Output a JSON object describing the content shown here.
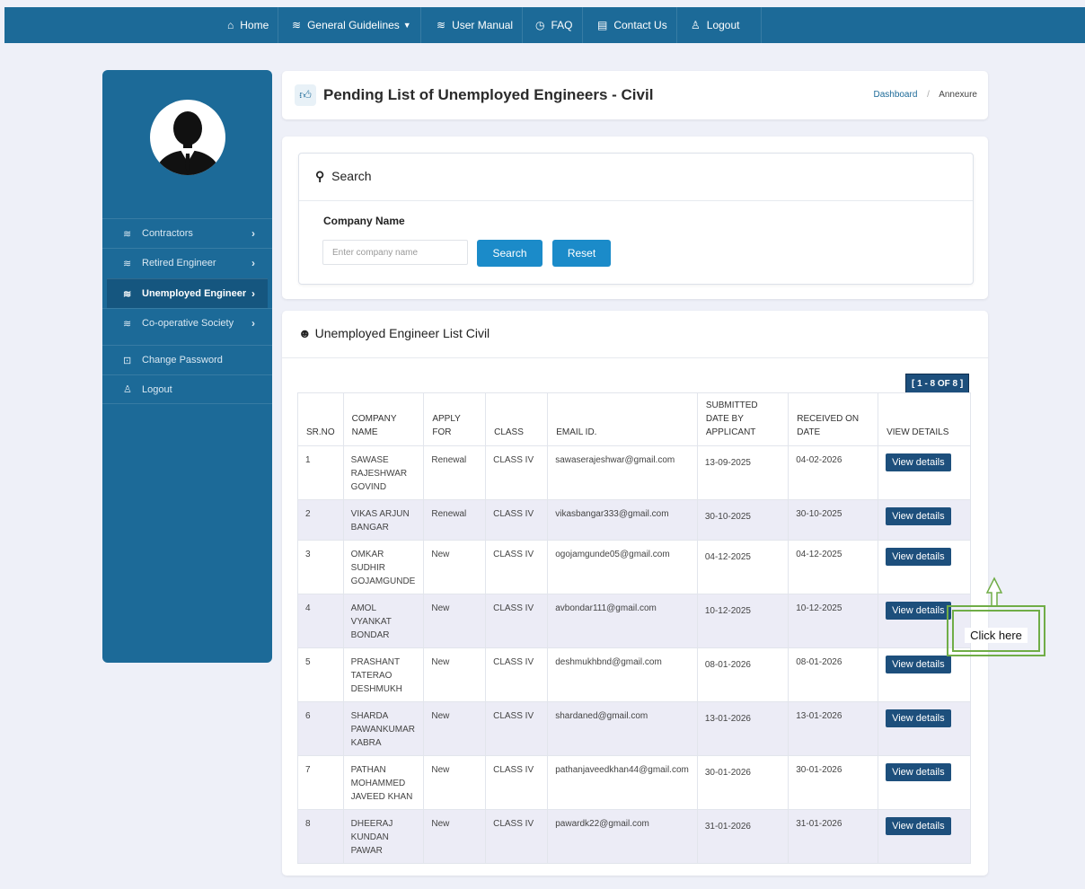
{
  "topnav": {
    "items": [
      {
        "label": "Home",
        "icon": "home-icon"
      },
      {
        "label": "General Guidelines",
        "icon": "layers-icon"
      },
      {
        "label": "User Manual",
        "icon": "layers-icon"
      },
      {
        "label": "FAQ",
        "icon": "clock-icon"
      },
      {
        "label": "Contact Us",
        "icon": "document-icon"
      },
      {
        "label": "Logout",
        "icon": "user-icon"
      }
    ]
  },
  "sidebar": {
    "items": [
      {
        "label": "Contractors",
        "icon": "layers-icon",
        "chevron": "›"
      },
      {
        "label": "Retired Engineer",
        "icon": "layers-icon",
        "chevron": "›"
      },
      {
        "label": "Unemployed Engineer",
        "icon": "layers-icon",
        "chevron": "›",
        "active": true
      },
      {
        "label": "Co-operative Society",
        "icon": "layers-icon",
        "chevron": "›"
      },
      {
        "label": "Change Password",
        "icon": "lock-icon"
      },
      {
        "label": "Logout",
        "icon": "user-icon"
      }
    ]
  },
  "header": {
    "title": "Pending List of Unemployed Engineers - Civil",
    "breadcrumb": {
      "link": "Dashboard",
      "sep": "/",
      "current": "Annexure"
    }
  },
  "search": {
    "title": "Search",
    "field_label": "Company Name",
    "input_value": "",
    "placeholder": "Enter company name",
    "search_label": "Search",
    "reset_label": "Reset"
  },
  "list": {
    "title": "Unemployed Engineer List Civil",
    "count": "[ 1 - 8 OF 8 ]",
    "columns": [
      "SR.NO",
      "COMPANY NAME",
      "APPLY FOR",
      "CLASS",
      "EMAIL ID.",
      "SUBMITTED DATE BY APPLICANT",
      "RECEIVED ON DATE",
      "VIEW DETAILS"
    ],
    "button_label": "View details",
    "rows": [
      {
        "sr": "1",
        "name": "SAWASE RAJESHWAR GOVIND",
        "apply": "Renewal",
        "cls": "CLASS IV",
        "email": "sawaserajeshwar@gmail.com",
        "submitted": "13-09-2025",
        "received": "04-02-2026"
      },
      {
        "sr": "2",
        "name": "VIKAS ARJUN BANGAR",
        "apply": "Renewal",
        "cls": "CLASS IV",
        "email": "vikasbangar333@gmail.com",
        "submitted": "30-10-2025",
        "received": "30-10-2025"
      },
      {
        "sr": "3",
        "name": "OMKAR SUDHIR GOJAMGUNDE",
        "apply": "New",
        "cls": "CLASS IV",
        "email": "ogojamgunde05@gmail.com",
        "submitted": "04-12-2025",
        "received": "04-12-2025"
      },
      {
        "sr": "4",
        "name": "AMOL VYANKAT BONDAR",
        "apply": "New",
        "cls": "CLASS IV",
        "email": "avbondar111@gmail.com",
        "submitted": "10-12-2025",
        "received": "10-12-2025"
      },
      {
        "sr": "5",
        "name": "PRASHANT TATERAO DESHMUKH",
        "apply": "New",
        "cls": "CLASS IV",
        "email": "deshmukhbnd@gmail.com",
        "submitted": "08-01-2026",
        "received": "08-01-2026"
      },
      {
        "sr": "6",
        "name": "SHARDA PAWANKUMAR KABRA",
        "apply": "New",
        "cls": "CLASS IV",
        "email": "shardaned@gmail.com",
        "submitted": "13-01-2026",
        "received": "13-01-2026"
      },
      {
        "sr": "7",
        "name": "PATHAN MOHAMMED JAVEED KHAN",
        "apply": "New",
        "cls": "CLASS IV",
        "email": "pathanjaveedkhan44@gmail.com",
        "submitted": "30-01-2026",
        "received": "30-01-2026"
      },
      {
        "sr": "8",
        "name": "DHEERAJ KUNDAN PAWAR",
        "apply": "New",
        "cls": "CLASS IV",
        "email": "pawardk22@gmail.com",
        "submitted": "31-01-2026",
        "received": "31-01-2026"
      }
    ]
  },
  "annotation": {
    "text": "Click here",
    "color": "#70ad47"
  },
  "colors": {
    "primary": "#1c6a98",
    "button": "#1b8bc9",
    "dark_button": "#1d4f7c",
    "background": "#eef0f8"
  }
}
